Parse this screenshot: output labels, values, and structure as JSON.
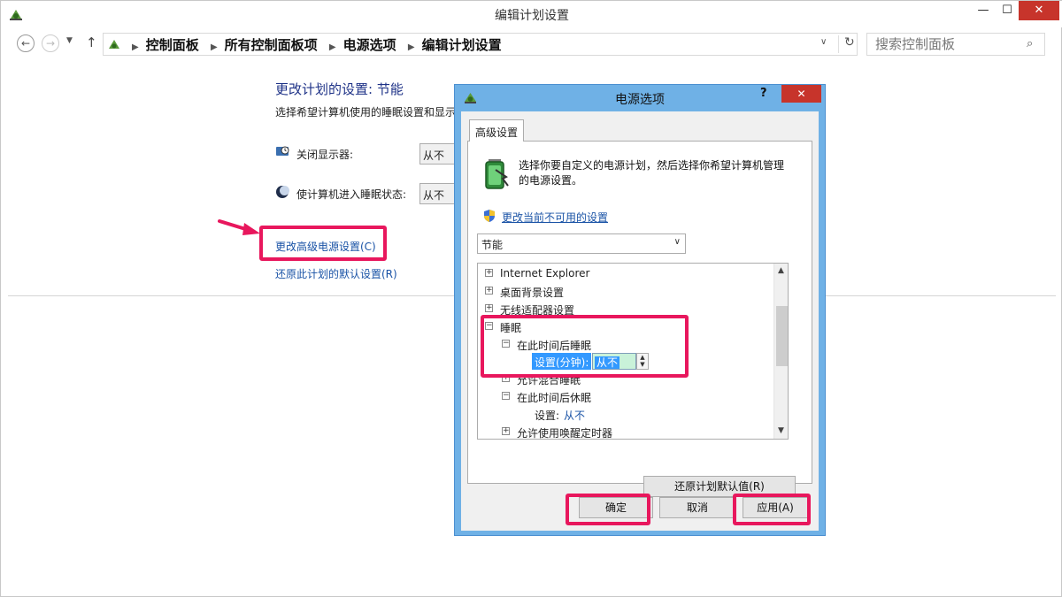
{
  "window": {
    "title": "编辑计划设置",
    "min_glyph": "—",
    "max_glyph": "☐",
    "close_glyph": "✕"
  },
  "nav": {
    "back_glyph": "←",
    "forward_glyph": "→",
    "recent_glyph": "▼",
    "up_glyph": "↑",
    "breadcrumb": [
      "控制面板",
      "所有控制面板项",
      "电源选项",
      "编辑计划设置"
    ],
    "breadcrumb_sep": "▶",
    "dropdown_glyph": "∨",
    "refresh_glyph": "↻",
    "search_placeholder": "搜索控制面板",
    "search_glyph": "⌕"
  },
  "content": {
    "heading": "更改计划的设置: 节能",
    "description": "选择希望计算机使用的睡眠设置和显示",
    "settings": [
      {
        "label": "关闭显示器:",
        "value": "从不"
      },
      {
        "label": "使计算机进入睡眠状态:",
        "value": "从不"
      }
    ],
    "advanced_link": "更改高级电源设置(C)",
    "restore_link": "还原此计划的默认设置(R)"
  },
  "dialog": {
    "title": "电源选项",
    "help_glyph": "?",
    "close_glyph": "✕",
    "tab_label": "高级设置",
    "description": "选择你要自定义的电源计划，然后选择你希望计算机管理的电源设置。",
    "unavailable_link": "更改当前不可用的设置",
    "plan_select": "节能",
    "plan_caret": "∨",
    "tree": [
      {
        "label": "Internet Explorer",
        "toggle": "+"
      },
      {
        "label": "桌面背景设置",
        "toggle": "+"
      },
      {
        "label": "无线适配器设置",
        "toggle": "+"
      },
      {
        "label": "睡眠",
        "toggle": "−"
      },
      {
        "label": "在此时间后睡眠",
        "toggle": "−"
      },
      {
        "label": "设置(分钟):",
        "value": "从不"
      },
      {
        "label": "允许混合睡眠",
        "toggle": "+"
      },
      {
        "label": "在此时间后休眠",
        "toggle": "−"
      },
      {
        "label": "设置:",
        "value": "从不"
      },
      {
        "label": "允许使用唤醒定时器",
        "toggle": "+"
      }
    ],
    "spin_up": "▲",
    "spin_down": "▼",
    "scroll_up": "▲",
    "scroll_down": "▼",
    "restore_defaults_btn": "还原计划默认值(R)",
    "ok_btn": "确定",
    "cancel_btn": "取消",
    "apply_btn": "应用(A)"
  },
  "colors": {
    "highlight": "#e8175d",
    "link": "#1a53a6",
    "heading": "#1e3287",
    "dialog_frame": "#6fb1e6",
    "close_red": "#c7342b",
    "selection": "#3399ff"
  }
}
